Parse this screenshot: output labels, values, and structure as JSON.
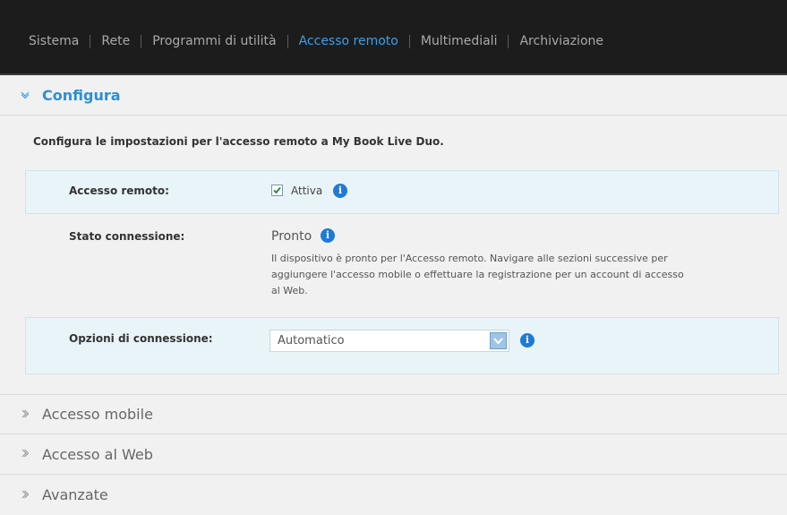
{
  "nav": {
    "tabs": [
      {
        "label": "Sistema"
      },
      {
        "label": "Rete"
      },
      {
        "label": "Programmi di utilità"
      },
      {
        "label": "Accesso remoto"
      },
      {
        "label": "Multimediali"
      },
      {
        "label": "Archiviazione"
      }
    ],
    "active": "Accesso remoto"
  },
  "configura": {
    "title": "Configura",
    "description": "Configura le impostazioni per l'accesso remoto a My Book Live Duo.",
    "remote_access": {
      "label": "Accesso remoto:",
      "checkbox_label": "Attiva",
      "checked": true
    },
    "connection_status": {
      "label": "Stato connessione:",
      "value": "Pronto",
      "detail_lines": [
        "Il dispositivo è pronto per l'Accesso remoto. Navigare alle sezioni successive per",
        "aggiungere l'accesso mobile o effettuare la registrazione per un account di accesso",
        "al Web."
      ]
    },
    "connection_options": {
      "label": "Opzioni di connessione:",
      "selected": "Automatico"
    }
  },
  "collapsed_sections": [
    {
      "title": "Accesso mobile"
    },
    {
      "title": "Accesso al Web"
    },
    {
      "title": "Avanzate"
    }
  ],
  "colors": {
    "nav_bg": "#1c1c1c",
    "nav_active": "#3aa0e8",
    "accent": "#2b8fd6",
    "info_icon": "#1f7ad6",
    "highlight_row": "#e9f4f9"
  },
  "icons": {
    "expanded": "chevron-down-icon",
    "collapsed": "chevron-right-icon",
    "info": "info-icon",
    "check": "checkmark-icon",
    "dropdown": "dropdown-arrow-icon"
  }
}
